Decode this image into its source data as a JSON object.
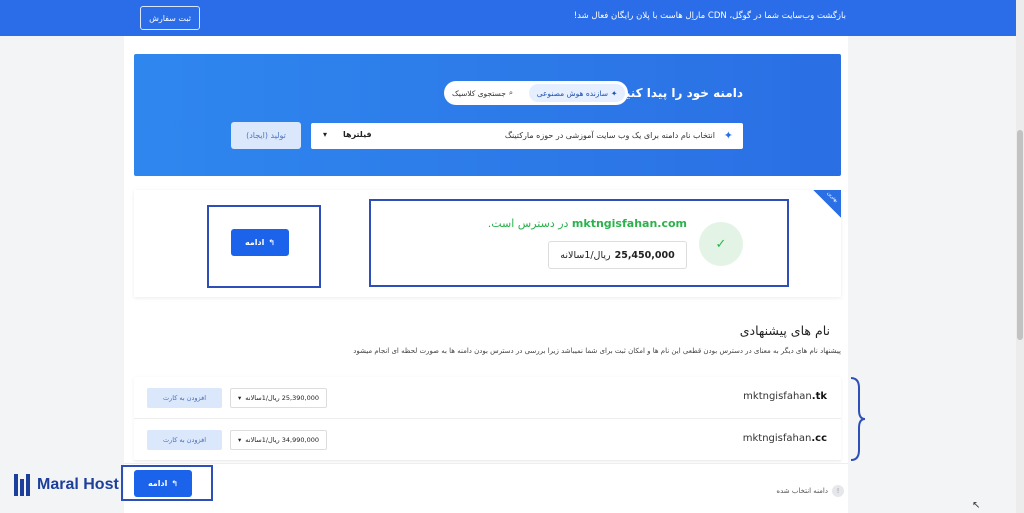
{
  "topbar": {
    "message": "بازگشت وب‌سایت شما در گوگل، CDN ماراِل هاست با پلان رایگان فعال شد!",
    "order_button": "ثبت سفارش"
  },
  "hero": {
    "title": "دامنه خود را پیدا کنید:",
    "ai_mode": "سازنده هوش مصنوعی",
    "classic_mode": "جستجوی کلاسیک",
    "search_value": "انتخاب نام دامنه برای یک وب سایت آموزشی در حوزه مارکتینگ",
    "filters_label": "فیلترها",
    "generate_button": "تولید (ایجاد)"
  },
  "result": {
    "ribbon": "بهترین",
    "domain": "mktngisfahan.com",
    "status": " در دسترس است.",
    "price": "25,450,000",
    "period": "ریال/1سالانه",
    "continue_label": "ادامه"
  },
  "suggestions": {
    "title": "نام های پیشنهادی",
    "description": "پیشنهاد نام های دیگر به معنای در دسترس بودن قطعی این نام ها و امکان ثبت برای شما نمیباشد زیرا بررسی در دسترس بودن دامنه ها به صورت لحظه ای انجام میشود",
    "items": [
      {
        "name": "mktngisfahan",
        "tld": ".tk",
        "price": "25,390,000 ریال/1سالانه",
        "add": "افزودن به کارت"
      },
      {
        "name": "mktngisfahan",
        "tld": ".cc",
        "price": "34,990,000 ریال/1سالانه",
        "add": "افزودن به کارت"
      }
    ]
  },
  "footer": {
    "selected_text": "دامنه انتخاب شده",
    "continue_label": "ادامه"
  },
  "logo": {
    "text": "Maral Host"
  },
  "colors": {
    "primary": "#1a63ea",
    "available": "#2bb24c",
    "highlight": "#2e4fb8"
  }
}
